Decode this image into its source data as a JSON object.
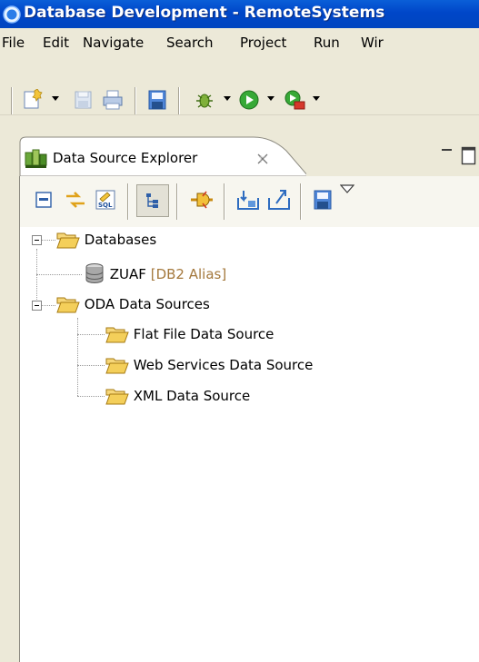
{
  "window": {
    "title": "Database Development - RemoteSystems"
  },
  "menu": {
    "items": [
      "File",
      "Edit",
      "Navigate",
      "Search",
      "Project",
      "Run",
      "Wir"
    ]
  },
  "view": {
    "tab_title": "Data Source Explorer",
    "tab_icon": "data-source-explorer-icon",
    "close_glyph": "✕"
  },
  "tree": {
    "databases": {
      "label": "Databases"
    },
    "zuaf": {
      "label": "ZUAF",
      "decoration": "[DB2 Alias]"
    },
    "oda": {
      "label": "ODA Data Sources"
    },
    "flat_file": {
      "label": "Flat File Data Source"
    },
    "web_services": {
      "label": "Web Services Data Source"
    },
    "xml": {
      "label": "XML Data Source"
    }
  },
  "colors": {
    "title_bar": "#0045c0",
    "chrome": "#ece9d8",
    "tree_background": "#ffffff",
    "decoration_text": "#a4783c",
    "folder": "#f4cf5a"
  }
}
